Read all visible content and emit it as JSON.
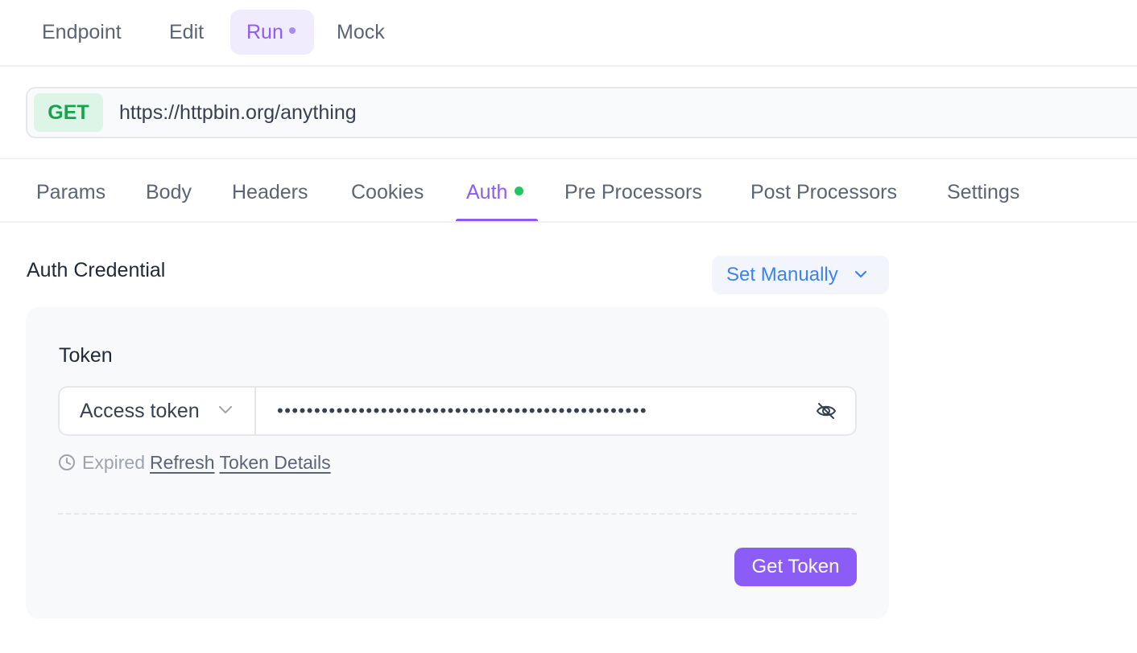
{
  "mode_tabs": [
    {
      "label": "Endpoint"
    },
    {
      "label": "Edit"
    },
    {
      "label": "Run"
    },
    {
      "label": "Mock"
    }
  ],
  "request": {
    "method": "GET",
    "url": "https://httpbin.org/anything"
  },
  "request_tabs": [
    {
      "label": "Params"
    },
    {
      "label": "Body"
    },
    {
      "label": "Headers"
    },
    {
      "label": "Cookies"
    },
    {
      "label": "Auth"
    },
    {
      "label": "Pre Processors"
    },
    {
      "label": "Post Processors"
    },
    {
      "label": "Settings"
    }
  ],
  "auth": {
    "title": "Auth Credential",
    "mode_label": "Set Manually",
    "token_label": "Token",
    "token_type": "Access token",
    "token_value_masked": "••••••••••••••••••••••••••••••••••••••••••••••••••",
    "status": "Expired",
    "refresh_link": "Refresh",
    "details_link": "Token Details",
    "get_token_label": "Get Token"
  },
  "colors": {
    "accent": "#8b5cf6",
    "method_get": "#16a34a",
    "link_blue": "#3b82f6",
    "auth_dot": "#22c55e"
  },
  "icons": {
    "mode_dropdown": "chevron-down-icon",
    "token_type_dropdown": "chevron-down-icon",
    "visibility": "eye-off-icon",
    "status": "clock-icon"
  }
}
